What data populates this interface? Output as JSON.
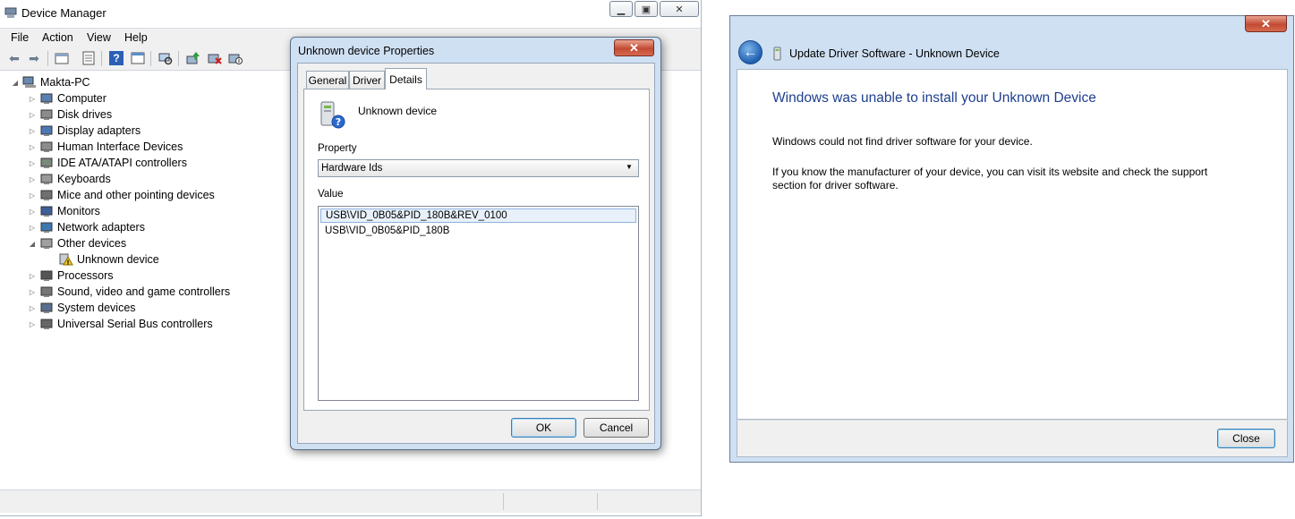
{
  "device_manager": {
    "title": "Device Manager",
    "menu": [
      "File",
      "Action",
      "View",
      "Help"
    ],
    "toolbar_icons": [
      "back-arrow-icon",
      "forward-arrow-icon",
      "show-hide-tree-icon",
      "properties-icon",
      "help-icon",
      "details-view-icon",
      "scan-hardware-icon",
      "update-driver-icon",
      "uninstall-icon",
      "disable-icon"
    ],
    "tree": {
      "root": "Makta-PC",
      "categories": [
        {
          "label": "Computer",
          "icon": "computer-icon",
          "expanded": false
        },
        {
          "label": "Disk drives",
          "icon": "disk-drive-icon",
          "expanded": false
        },
        {
          "label": "Display adapters",
          "icon": "display-adapter-icon",
          "expanded": false
        },
        {
          "label": "Human Interface Devices",
          "icon": "hid-icon",
          "expanded": false
        },
        {
          "label": "IDE ATA/ATAPI controllers",
          "icon": "ide-controller-icon",
          "expanded": false
        },
        {
          "label": "Keyboards",
          "icon": "keyboard-icon",
          "expanded": false
        },
        {
          "label": "Mice and other pointing devices",
          "icon": "mouse-icon",
          "expanded": false
        },
        {
          "label": "Monitors",
          "icon": "monitor-icon",
          "expanded": false
        },
        {
          "label": "Network adapters",
          "icon": "network-adapter-icon",
          "expanded": false
        },
        {
          "label": "Other devices",
          "icon": "other-devices-icon",
          "expanded": true,
          "children": [
            "Unknown device"
          ]
        },
        {
          "label": "Processors",
          "icon": "processor-icon",
          "expanded": false
        },
        {
          "label": "Sound, video and game controllers",
          "icon": "sound-icon",
          "expanded": false
        },
        {
          "label": "System devices",
          "icon": "system-device-icon",
          "expanded": false
        },
        {
          "label": "Universal Serial Bus controllers",
          "icon": "usb-icon",
          "expanded": false
        }
      ]
    }
  },
  "properties_dialog": {
    "title": "Unknown device Properties",
    "close_glyph": "✕",
    "tabs": [
      "General",
      "Driver",
      "Details"
    ],
    "active_tab": "Details",
    "device_name": "Unknown device",
    "property_label": "Property",
    "property_value": "Hardware Ids",
    "value_label": "Value",
    "values": [
      "USB\\VID_0B05&PID_180B&REV_0100",
      "USB\\VID_0B05&PID_180B"
    ],
    "selected_value_index": 0,
    "ok_label": "OK",
    "cancel_label": "Cancel"
  },
  "update_driver": {
    "title": "Update Driver Software - Unknown Device",
    "close_glyph": "✕",
    "heading": "Windows was unable to install your Unknown Device",
    "message1": "Windows could not find driver software for your device.",
    "message2_line1": "If you know the manufacturer of your device, you can visit its website and check the support",
    "message2_line2": "section for driver software.",
    "close_label": "Close",
    "heading_color": "#1e3f8f"
  }
}
